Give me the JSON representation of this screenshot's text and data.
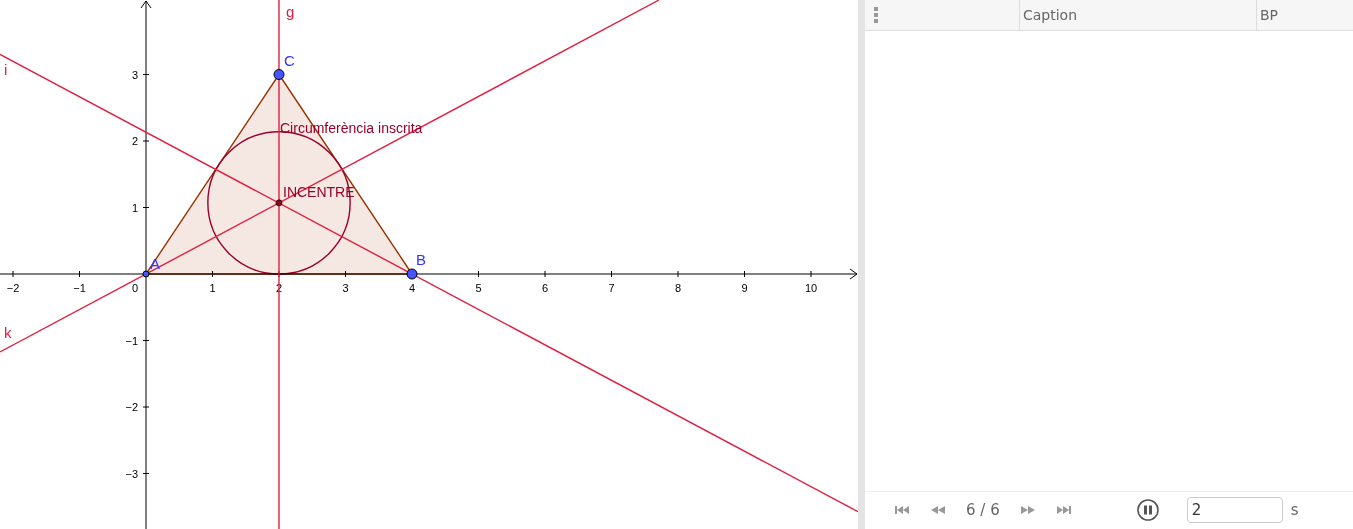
{
  "graphics": {
    "x_tick_labels": [
      "−2",
      "−1",
      "1",
      "2",
      "3",
      "4",
      "5",
      "6",
      "7",
      "8",
      "9",
      "10"
    ],
    "y_tick_labels": [
      "3",
      "2",
      "1",
      "−1",
      "−2",
      "−3"
    ],
    "origin_label": "0",
    "points": [
      {
        "label": "A"
      },
      {
        "label": "B"
      },
      {
        "label": "C"
      }
    ],
    "lines": [
      {
        "label": "g"
      },
      {
        "label": "i"
      },
      {
        "label": "k"
      }
    ],
    "texts": [
      "Circumferència inscrita",
      "INCENTRE"
    ]
  },
  "table": {
    "columns": [
      "Caption",
      "BP"
    ]
  },
  "playback": {
    "counter": "6 / 6",
    "speed": "2",
    "unit": "s",
    "playing": true
  }
}
